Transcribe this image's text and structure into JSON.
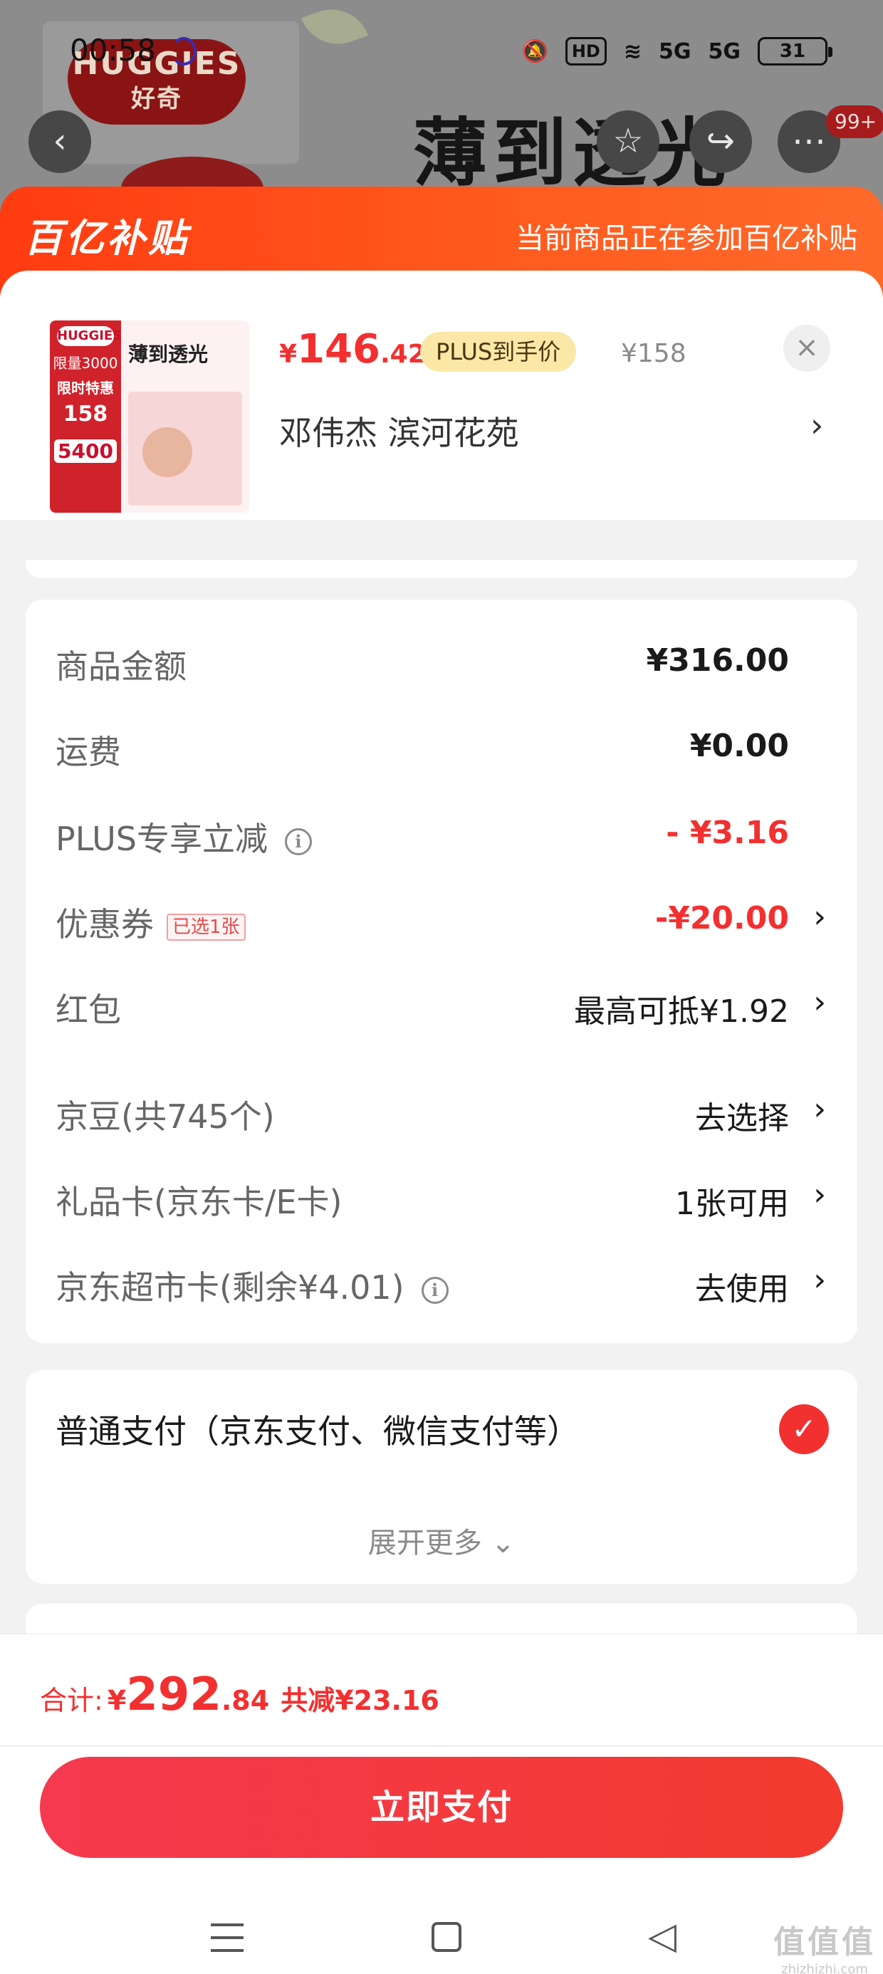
{
  "status_bar": {
    "time": "00:58",
    "hd_label": "HD",
    "net1": "5G",
    "net2": "5G",
    "battery": "31"
  },
  "background": {
    "brand_logo": "HUGGIES",
    "brand_logo_cn": "好奇",
    "headline": "薄到透光",
    "badge_count": "99+"
  },
  "sheet": {
    "logo": "百亿补贴",
    "tagline": "当前商品正在参加百亿补贴"
  },
  "product": {
    "thumb_title": "薄到透光",
    "thumb_brand": "HUGGIES",
    "thumb_line1": "限量3000",
    "thumb_line2": "限时特惠",
    "thumb_price": "158",
    "thumb_price2": "5400",
    "price_yen": "¥",
    "price_int": "146",
    "price_dec": ".42",
    "plus_tag": "PLUS到手价",
    "original_price": "¥158",
    "close_symbol": "×",
    "address": "邓伟杰  滨河花苑",
    "chevron": "›"
  },
  "price_rows": [
    {
      "label": "商品金额",
      "value": "¥316.00"
    },
    {
      "label": "运费",
      "value": "¥0.00"
    },
    {
      "label": "PLUS专享立减",
      "value": "- ¥3.16",
      "info": "i"
    },
    {
      "label": "优惠券",
      "tag": "已选1张",
      "value": "-¥20.00"
    },
    {
      "label": "红包",
      "value": "最高可抵¥1.92"
    },
    {
      "label": "京豆(共745个)",
      "value": "去选择"
    },
    {
      "label": "礼品卡(京东卡/E卡)",
      "value": "1张可用"
    },
    {
      "label": "京东超市卡(剩余¥4.01)",
      "value": "去使用",
      "info": "i"
    }
  ],
  "payment": {
    "method": "普通支付（京东支付、微信支付等）",
    "check_symbol": "✓",
    "expand_more": "展开更多 ⌄"
  },
  "bottom": {
    "total_label": "合计:",
    "total_yen": "¥",
    "total_int": "292",
    "total_dec": ".84",
    "saved": "共减¥23.16",
    "pay_button": "立即支付"
  },
  "watermark": {
    "main": "值值值",
    "sub": "zhizhizhi.com"
  },
  "colors": {
    "accent_red": "#f23030",
    "header_orange": "#ff4a18",
    "plus_gold": "#fbe7a6"
  }
}
